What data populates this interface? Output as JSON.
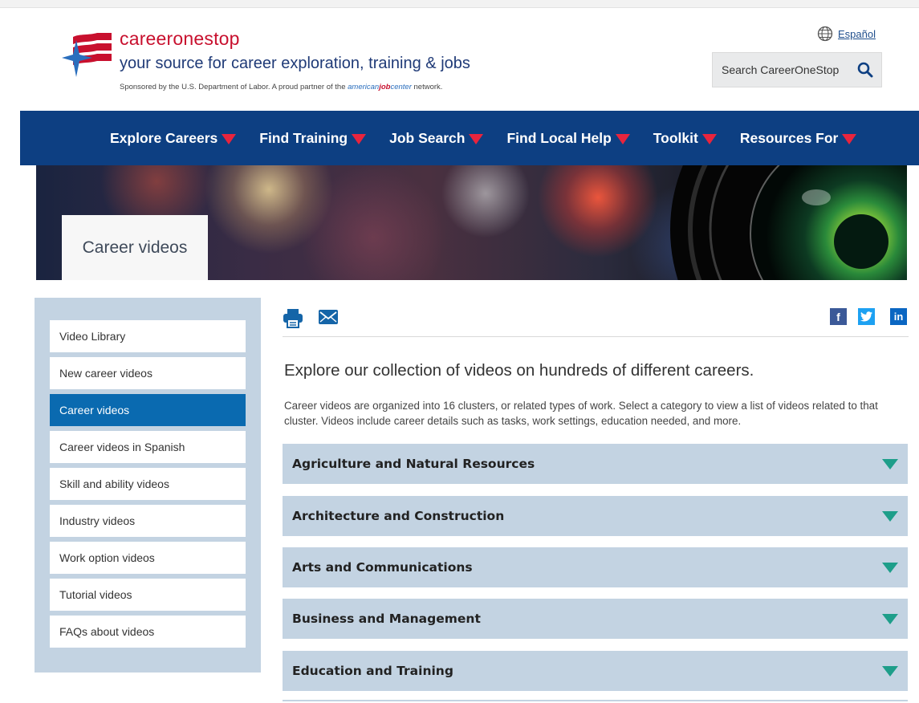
{
  "header": {
    "brand_name": "careeronestop",
    "tagline": "your source for career exploration, training & jobs",
    "sponsor_prefix": "Sponsored by the U.S. Department of Labor. A proud partner of the",
    "ajc_part1": "american",
    "ajc_part2": "job",
    "ajc_part3": "center",
    "sponsor_suffix": "network.",
    "language_link": "Español",
    "search_placeholder": "Search CareerOneStop"
  },
  "nav": {
    "items": [
      {
        "label": "Explore Careers"
      },
      {
        "label": "Find Training"
      },
      {
        "label": "Job Search"
      },
      {
        "label": "Find Local Help"
      },
      {
        "label": "Toolkit"
      },
      {
        "label": "Resources For"
      }
    ]
  },
  "banner": {
    "title": "Career videos"
  },
  "sidebar": {
    "items": [
      {
        "label": "Video Library"
      },
      {
        "label": "New career videos"
      },
      {
        "label": "Career videos"
      },
      {
        "label": "Career videos in Spanish"
      },
      {
        "label": "Skill and ability videos"
      },
      {
        "label": "Industry videos"
      },
      {
        "label": "Work option videos"
      },
      {
        "label": "Tutorial videos"
      },
      {
        "label": "FAQs about videos"
      }
    ],
    "active_index": 2
  },
  "main": {
    "heading": "Explore our collection of videos on hundreds of different careers.",
    "description": "Career videos are organized into 16 clusters, or related types of work. Select a category to view a list of videos related to that cluster. Videos include career details such as tasks, work settings, education needed, and more.",
    "social": {
      "facebook": "f",
      "twitter": "t",
      "linkedin": "in"
    },
    "clusters": [
      {
        "label": "Agriculture and Natural Resources"
      },
      {
        "label": "Architecture and Construction"
      },
      {
        "label": "Arts and Communications"
      },
      {
        "label": "Business and Management"
      },
      {
        "label": "Education and Training"
      }
    ]
  },
  "colors": {
    "nav_bg": "#0d3f82",
    "nav_arrow": "#e8243d",
    "accent_blue": "#0a6ab0",
    "panel": "#c3d3e2",
    "accordion_arrow": "#1e9e8a",
    "brand_red": "#c8102e"
  }
}
